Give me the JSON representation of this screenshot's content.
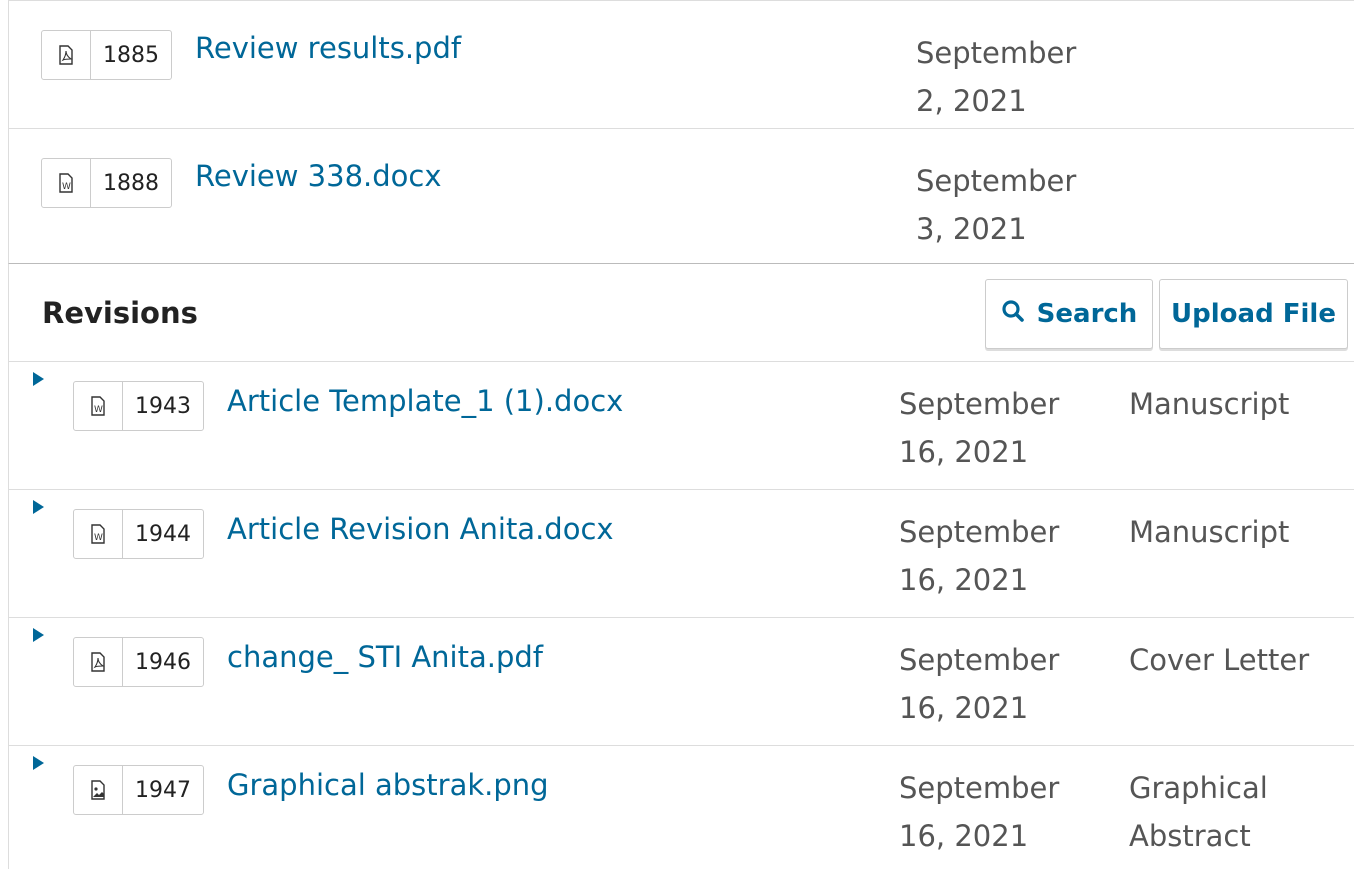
{
  "review_files": [
    {
      "icon": "pdf-file-icon",
      "id": "1885",
      "name": "Review results.pdf",
      "date_line1": "September",
      "date_line2": "2, 2021"
    },
    {
      "icon": "word-file-icon",
      "id": "1888",
      "name": "Review 338.docx",
      "date_line1": "September",
      "date_line2": "3, 2021"
    }
  ],
  "revisions": {
    "title": "Revisions",
    "search_label": "Search",
    "upload_label": "Upload File",
    "files": [
      {
        "icon": "word-file-icon",
        "id": "1943",
        "name": "Article Template_1 (1).docx",
        "date_line1": "September",
        "date_line2": "16, 2021",
        "genre_line1": "Manuscript",
        "genre_line2": ""
      },
      {
        "icon": "word-file-icon",
        "id": "1944",
        "name": "Article Revision Anita.docx",
        "date_line1": "September",
        "date_line2": "16, 2021",
        "genre_line1": "Manuscript",
        "genre_line2": ""
      },
      {
        "icon": "pdf-file-icon",
        "id": "1946",
        "name": "change_ STI Anita.pdf",
        "date_line1": "September",
        "date_line2": "16, 2021",
        "genre_line1": "Cover Letter",
        "genre_line2": ""
      },
      {
        "icon": "image-file-icon",
        "id": "1947",
        "name": "Graphical abstrak.png",
        "date_line1": "September",
        "date_line2": "16, 2021",
        "genre_line1": "Graphical",
        "genre_line2": "Abstract"
      }
    ]
  },
  "colors": {
    "link": "#006798",
    "border": "#dddddd",
    "muted_text": "#555555"
  }
}
